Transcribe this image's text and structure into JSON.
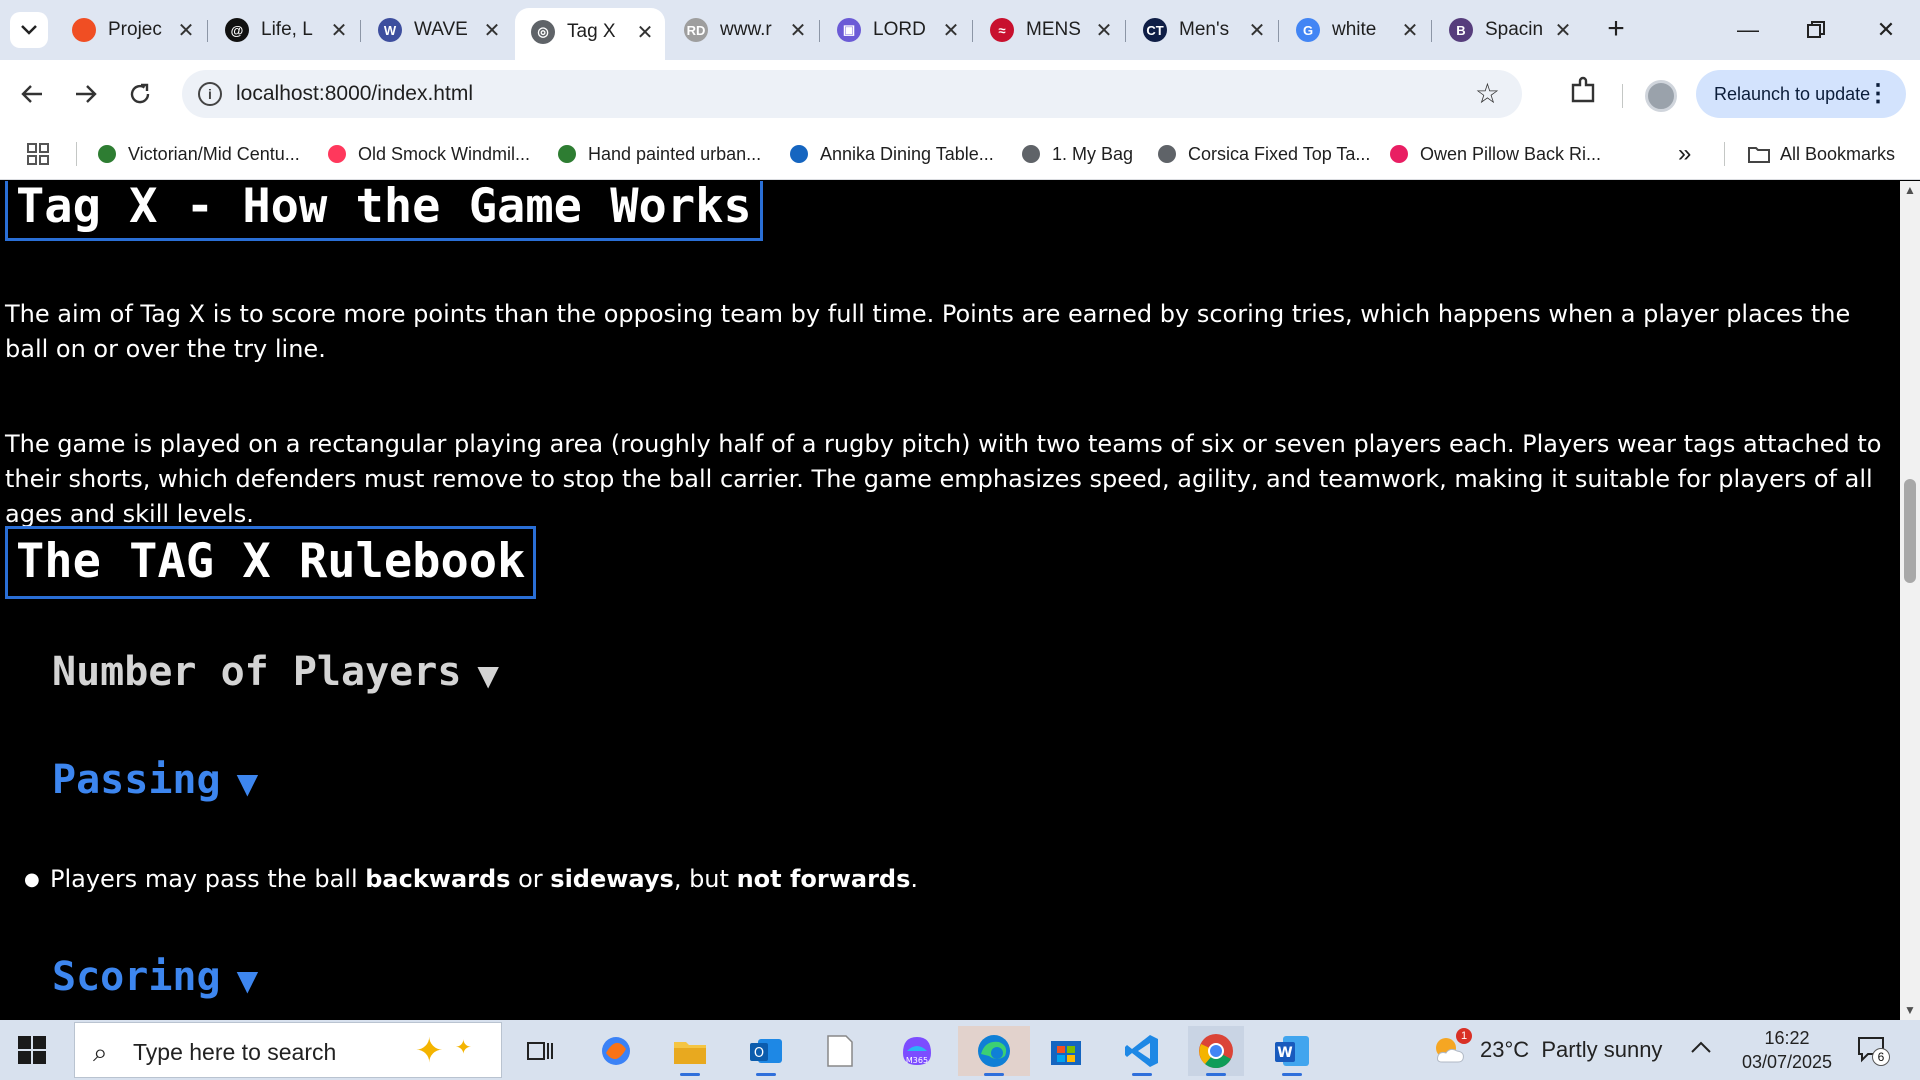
{
  "browser": {
    "tabs": [
      {
        "title": "Projec",
        "fav_color": "#f04e23",
        "fav_glyph": ""
      },
      {
        "title": "Life, L",
        "fav_color": "#111111",
        "fav_glyph": "@"
      },
      {
        "title": "WAVE",
        "fav_color": "#3d4e9e",
        "fav_glyph": "W"
      },
      {
        "title": "Tag X",
        "fav_color": "#5f6368",
        "fav_glyph": "◎"
      },
      {
        "title": "www.r",
        "fav_color": "#9e9e9e",
        "fav_glyph": "RD"
      },
      {
        "title": "LORD",
        "fav_color": "#6b5bd6",
        "fav_glyph": "▣"
      },
      {
        "title": "MENS",
        "fav_color": "#c8102e",
        "fav_glyph": "≈"
      },
      {
        "title": "Men's",
        "fav_color": "#0f1e46",
        "fav_glyph": "CT"
      },
      {
        "title": "white",
        "fav_color": "#4285f4",
        "fav_glyph": "G"
      },
      {
        "title": "Spacin",
        "fav_color": "#563d7c",
        "fav_glyph": "B"
      }
    ],
    "active_tab": "Tag X",
    "url": "localhost:8000/index.html",
    "relaunch_label": "Relaunch to update",
    "bookmarks": [
      {
        "label": "Victorian/Mid Centu...",
        "color": "#2e7d32"
      },
      {
        "label": "Old Smock Windmil...",
        "color": "#ff385c"
      },
      {
        "label": "Hand painted urban...",
        "color": "#2e7d32"
      },
      {
        "label": "Annika Dining Table...",
        "color": "#1565c0"
      },
      {
        "label": "1. My Bag",
        "color": "#5f6368"
      },
      {
        "label": "Corsica Fixed Top Ta...",
        "color": "#5f6368"
      },
      {
        "label": "Owen Pillow Back Ri...",
        "color": "#e91e63"
      }
    ],
    "all_bookmarks_label": "All Bookmarks"
  },
  "page": {
    "heading_main": "Tag X - How the Game Works",
    "para1": "The aim of Tag X is to score more points than the opposing team by full time. Points are earned by scoring tries, which happens when a player places the ball on or over the try line.",
    "para2": "The game is played on a rectangular playing area (roughly half of a rugby pitch) with two teams of six or seven players each. Players wear tags attached to their shorts, which defenders must remove to stop the ball carrier. The game emphasizes speed, agility, and teamwork, making it suitable for players of all ages and skill levels.",
    "heading_rulebook": "The TAG X Rulebook",
    "sections": [
      {
        "title": "Number of Players",
        "arrow": "▼",
        "color": "#d4d4d4"
      },
      {
        "title": "Passing",
        "arrow": "▼",
        "color": "#3d86ef"
      },
      {
        "title": "Scoring",
        "arrow": "▼",
        "color": "#3d86ef"
      }
    ],
    "passing_rule": {
      "t1": "Players may pass the ball ",
      "b1": "backwards",
      "t2": " or ",
      "b2": "sideways",
      "t3": ", but ",
      "b3": "not forwards",
      "t4": "."
    }
  },
  "taskbar": {
    "search_placeholder": "Type here to search",
    "weather_badge": "1",
    "weather": "23°C  Partly sunny",
    "time": "16:22",
    "date": "03/07/2025",
    "notif_count": "6"
  }
}
